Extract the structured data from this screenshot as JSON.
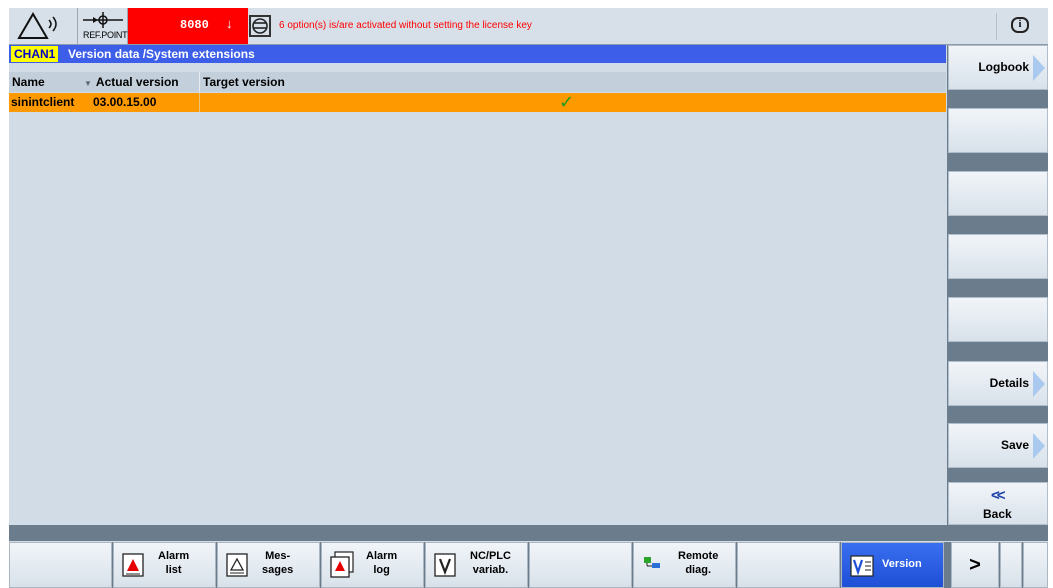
{
  "topbar": {
    "ref_point_label": "REF.POINT",
    "alarm_number": "8080",
    "alarm_arrow": "↓",
    "alarm_message": "6 option(s) is/are activated without setting the license key",
    "info_symbol": "i"
  },
  "title": {
    "channel": "CHAN1",
    "text": "Version data  /System extensions"
  },
  "table": {
    "columns": [
      "Name",
      "Actual version",
      "Target version"
    ],
    "sort_marker": "▼",
    "rows": [
      {
        "name": "sinintclient",
        "actual_version": "03.00.15.00",
        "target_version": "",
        "status": "✓"
      }
    ]
  },
  "vertical_softkeys": [
    {
      "label": "Logbook",
      "arrow": true
    },
    {
      "label": "",
      "arrow": false
    },
    {
      "label": "",
      "arrow": false
    },
    {
      "label": "",
      "arrow": false
    },
    {
      "label": "",
      "arrow": false
    },
    {
      "label": "Details",
      "arrow": true
    },
    {
      "label": "Save",
      "arrow": true
    },
    {
      "label": "Back",
      "chevron": "<<"
    }
  ],
  "horizontal_softkeys": [
    {
      "label": "",
      "icon": ""
    },
    {
      "label": "Alarm\nlist",
      "icon": "alarm-list-icon"
    },
    {
      "label": "Mes-\nsages",
      "icon": "messages-icon"
    },
    {
      "label": "Alarm\nlog",
      "icon": "alarm-log-icon"
    },
    {
      "label": "NC/PLC\nvariab.",
      "icon": "variables-icon"
    },
    {
      "label": "",
      "icon": ""
    },
    {
      "label": "Remote\ndiag.",
      "icon": "remote-diag-icon"
    },
    {
      "label": "",
      "icon": ""
    },
    {
      "label": "Version",
      "icon": "version-icon",
      "active": true
    }
  ],
  "more_key": ">",
  "colors": {
    "alarm_red": "#ff0000",
    "title_blue": "#3c5ee8",
    "row_orange": "#ff9900",
    "chan_yellow": "#ffff00",
    "check_green": "#1f9a1f"
  }
}
